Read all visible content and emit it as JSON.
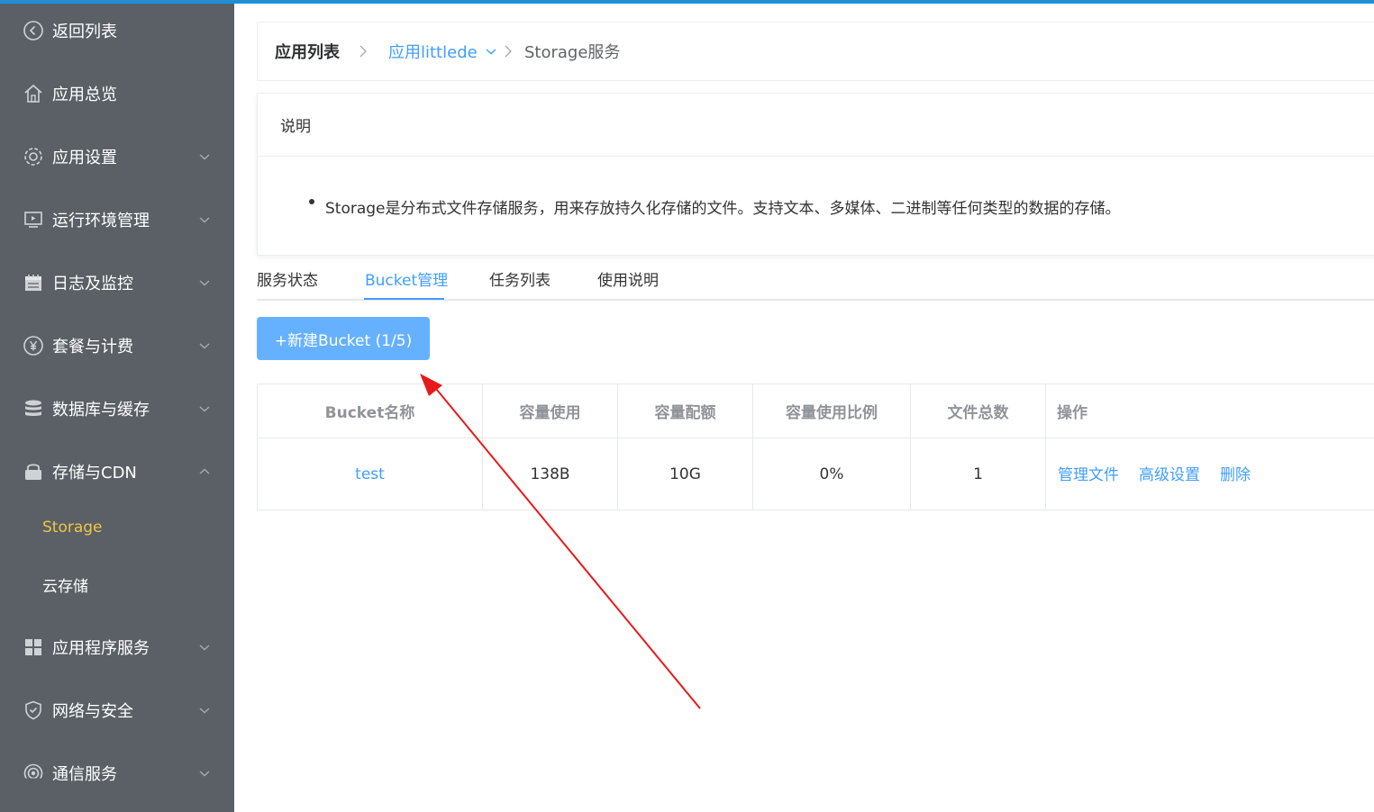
{
  "sidebar": {
    "back": "返回列表",
    "items": [
      {
        "label": "应用总览"
      },
      {
        "label": "应用设置"
      },
      {
        "label": "运行环境管理"
      },
      {
        "label": "日志及监控"
      },
      {
        "label": "套餐与计费"
      },
      {
        "label": "数据库与缓存"
      },
      {
        "label": "存储与CDN"
      },
      {
        "label": "应用程序服务"
      },
      {
        "label": "网络与安全"
      },
      {
        "label": "通信服务"
      }
    ],
    "sub_items": [
      {
        "label": "Storage",
        "active": true
      },
      {
        "label": "云存储",
        "active": false
      }
    ],
    "colors": {
      "bg": "#5a6066",
      "active": "#f0c545"
    }
  },
  "breadcrumb": {
    "root": "应用列表",
    "app": "应用littlede",
    "current": "Storage服务"
  },
  "description": {
    "title": "说明",
    "text": "Storage是分布式文件存储服务，用来存放持久化存储的文件。支持文本、多媒体、二进制等任何类型的数据的存储。"
  },
  "tabs": [
    {
      "label": "服务状态",
      "active": false
    },
    {
      "label": "Bucket管理",
      "active": true
    },
    {
      "label": "任务列表",
      "active": false
    },
    {
      "label": "使用说明",
      "active": false
    }
  ],
  "new_bucket_button": "+新建Bucket (1/5)",
  "table": {
    "headers": [
      "Bucket名称",
      "容量使用",
      "容量配额",
      "容量使用比例",
      "文件总数",
      "操作"
    ],
    "rows": [
      {
        "name": "test",
        "used": "138B",
        "quota": "10G",
        "ratio": "0%",
        "files": "1",
        "actions": [
          "管理文件",
          "高级设置",
          "删除"
        ]
      }
    ]
  },
  "accent_color": "#409eff",
  "annotation_arrow_color": "#e8191b"
}
